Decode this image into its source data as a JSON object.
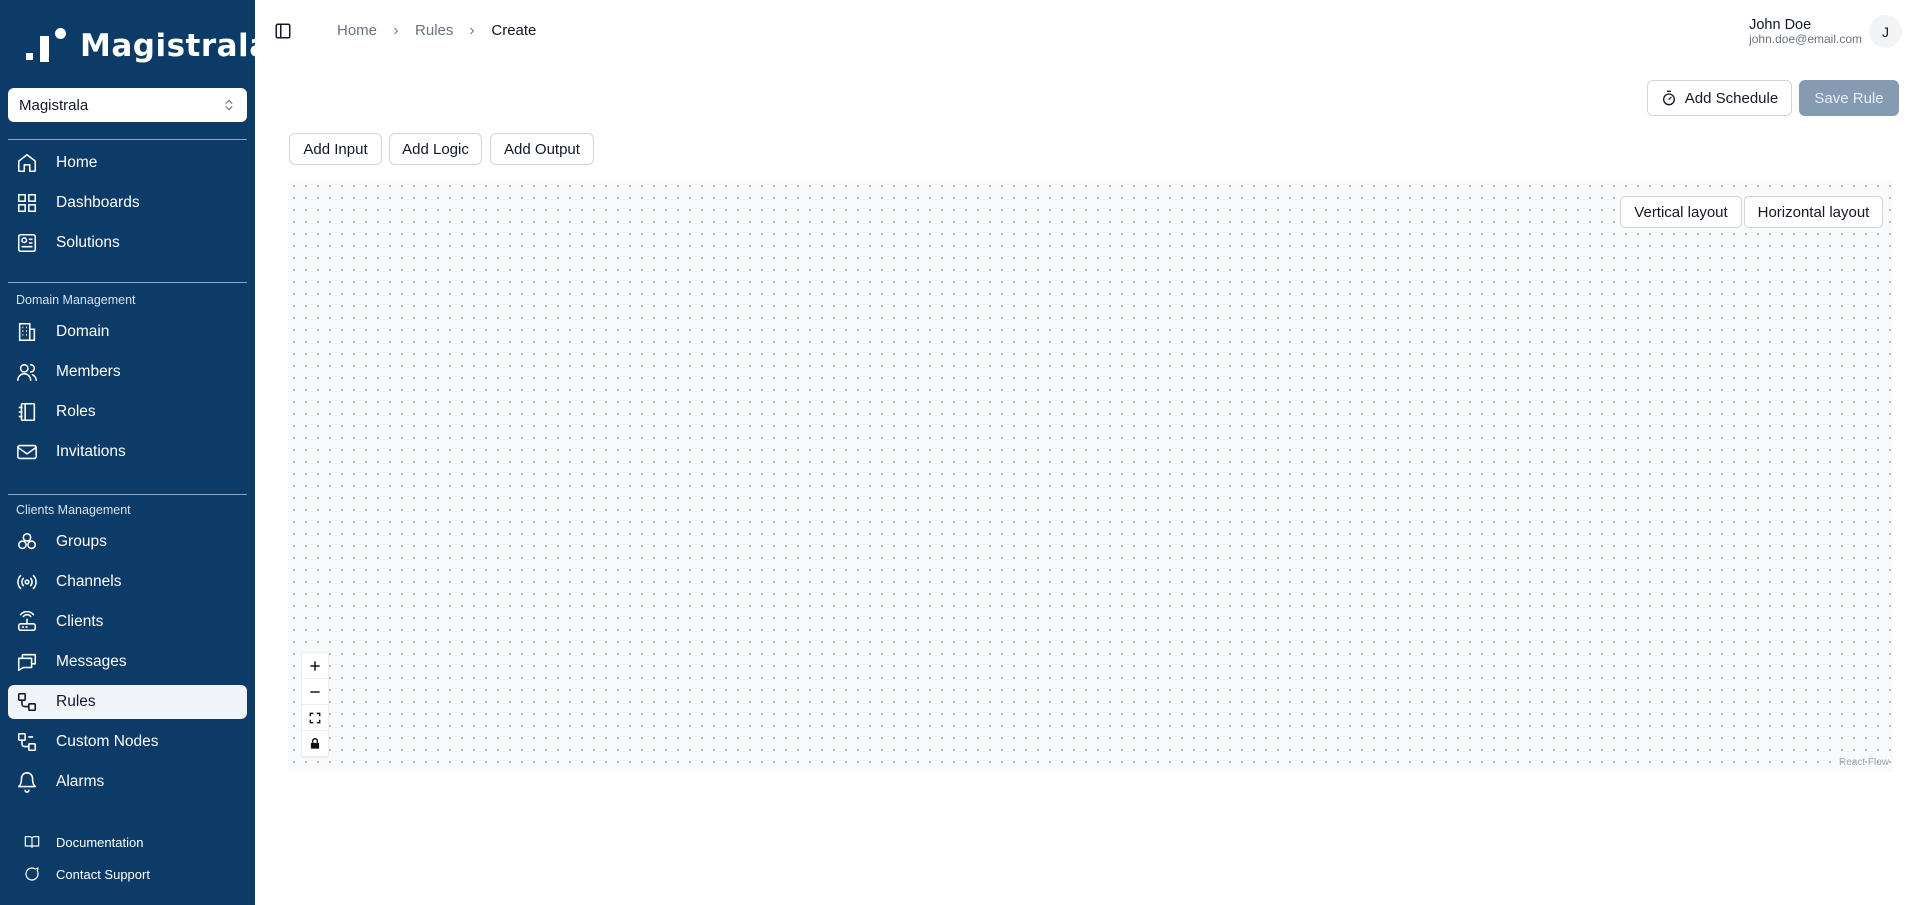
{
  "app": {
    "logo_text": "Magistrala"
  },
  "sidebar": {
    "domain_selector": {
      "value": "Magistrala"
    },
    "main_items": [
      {
        "label": "Home",
        "icon": "home-icon"
      },
      {
        "label": "Dashboards",
        "icon": "dashboard-icon"
      },
      {
        "label": "Solutions",
        "icon": "solutions-icon"
      }
    ],
    "domain_section": {
      "label": "Domain Management",
      "items": [
        {
          "label": "Domain",
          "icon": "building-icon"
        },
        {
          "label": "Members",
          "icon": "users-icon"
        },
        {
          "label": "Roles",
          "icon": "book-icon"
        },
        {
          "label": "Invitations",
          "icon": "mail-icon"
        }
      ]
    },
    "clients_section": {
      "label": "Clients Management",
      "items": [
        {
          "label": "Groups",
          "icon": "groups-icon"
        },
        {
          "label": "Channels",
          "icon": "broadcast-icon"
        },
        {
          "label": "Clients",
          "icon": "router-icon"
        },
        {
          "label": "Messages",
          "icon": "messages-icon"
        },
        {
          "label": "Rules",
          "icon": "rules-icon",
          "active": true
        },
        {
          "label": "Custom Nodes",
          "icon": "nodes-icon"
        },
        {
          "label": "Alarms",
          "icon": "bell-icon"
        }
      ]
    },
    "bottom_links": [
      {
        "label": "Documentation",
        "icon": "book-open-icon"
      },
      {
        "label": "Contact Support",
        "icon": "chat-icon"
      }
    ]
  },
  "header": {
    "breadcrumb": [
      "Home",
      "Rules",
      "Create"
    ],
    "user": {
      "name": "John Doe",
      "email": "john.doe@email.com",
      "initial": "J"
    }
  },
  "toolbar": {
    "add_schedule": "Add Schedule",
    "save_rule": "Save Rule",
    "add_input": "Add Input",
    "add_logic": "Add Logic",
    "add_output": "Add Output"
  },
  "canvas": {
    "vertical_layout": "Vertical layout",
    "horizontal_layout": "Horizontal layout",
    "attribution": "React Flow"
  },
  "colors": {
    "sidebar_bg": "#0b3b66",
    "save_disabled": "#859bb1",
    "canvas_bg": "#f8fafc"
  }
}
